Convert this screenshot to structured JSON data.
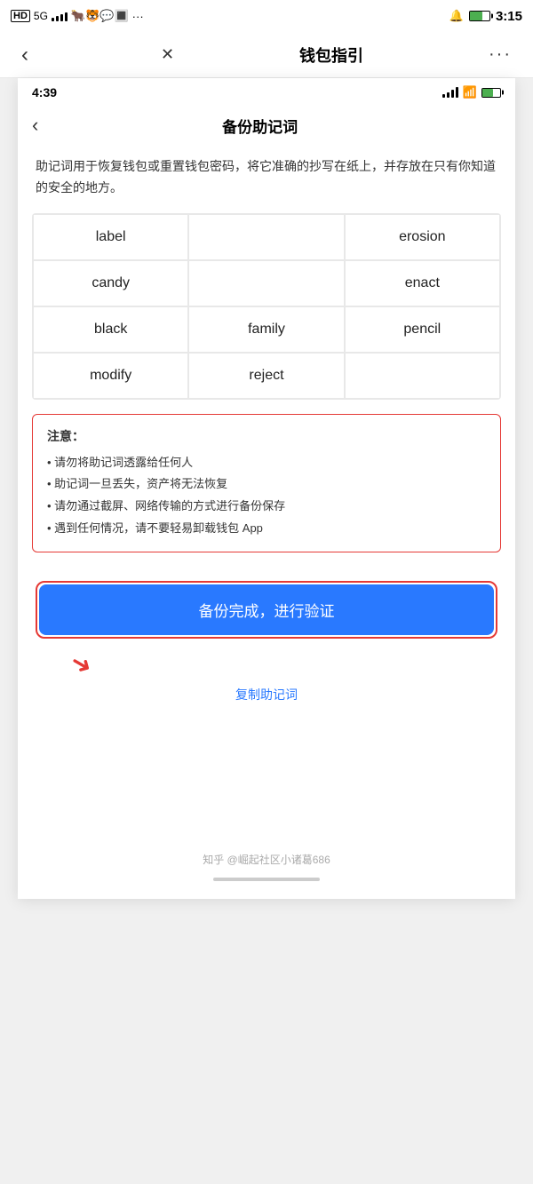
{
  "outer_status": {
    "left": "HD 5G",
    "time": "3:15",
    "bell_icon": "🔔",
    "battery_label": "battery"
  },
  "outer_nav": {
    "back_label": "‹",
    "close_label": "✕",
    "title": "钱包指引",
    "more_label": "···"
  },
  "inner_status": {
    "time": "4:39"
  },
  "inner_nav": {
    "back_label": "‹",
    "title": "备份助记词"
  },
  "description": {
    "text": "助记词用于恢复钱包或重置钱包密码，将它准确的抄写在纸上，并存放在只有你知道的安全的地方。"
  },
  "mnemonic": {
    "words": [
      {
        "text": "label",
        "position": "r1c1"
      },
      {
        "text": "",
        "position": "r1c2"
      },
      {
        "text": "erosion",
        "position": "r1c3"
      },
      {
        "text": "candy",
        "position": "r2c1"
      },
      {
        "text": "",
        "position": "r2c2"
      },
      {
        "text": "enact",
        "position": "r2c3"
      },
      {
        "text": "black",
        "position": "r3c1"
      },
      {
        "text": "family",
        "position": "r3c2"
      },
      {
        "text": "pencil",
        "position": "r3c3"
      },
      {
        "text": "modify",
        "position": "r4c1"
      },
      {
        "text": "reject",
        "position": "r4c2"
      },
      {
        "text": "",
        "position": "r4c3"
      }
    ]
  },
  "warning": {
    "title": "注意：",
    "items": [
      "• 请勿将助记词透露给任何人",
      "• 助记词一旦丢失，资产将无法恢复",
      "• 请勿通过截屏、网络传输的方式进行备份保存",
      "• 遇到任何情况，请不要轻易卸载钱包 App"
    ]
  },
  "backup_btn": {
    "label": "备份完成，进行验证"
  },
  "copy_link": {
    "label": "复制助记词"
  },
  "attribution": {
    "text": "知乎 @崛起社区小诸葛686"
  }
}
